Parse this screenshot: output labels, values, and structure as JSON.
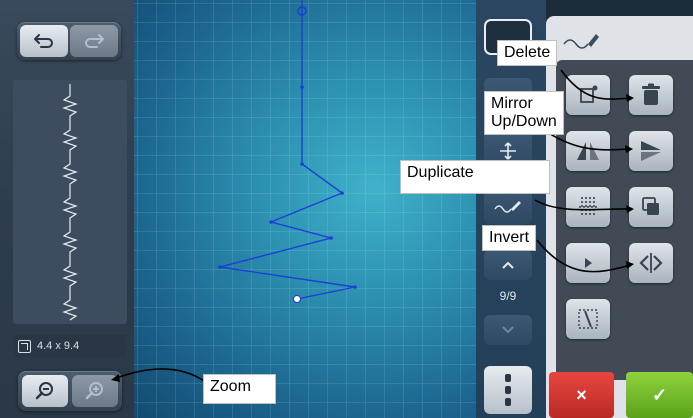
{
  "left_panel": {
    "undo_icon": "undo-arrow-icon",
    "redo_icon": "redo-arrow-icon",
    "size_icon": "resize-icon",
    "size_text": "4.4 x 9.4",
    "zoom_out_icon": "zoom-out-icon",
    "zoom_in_icon": "zoom-in-icon"
  },
  "tool_column": {
    "count": "9/9",
    "menu_icon": "vertical-dots-icon"
  },
  "right_panel": {
    "cancel_label": "×",
    "ok_label": "✓"
  },
  "callouts": {
    "delete": "Delete",
    "mirror_line1": "Mirror",
    "mirror_line2": "Up/Down",
    "duplicate": "Duplicate",
    "invert": "Invert",
    "zoom": "Zoom"
  },
  "colors": {
    "stitch_line": "#1b3fd8",
    "cancel": "#d23a33",
    "ok": "#6fb82a"
  }
}
